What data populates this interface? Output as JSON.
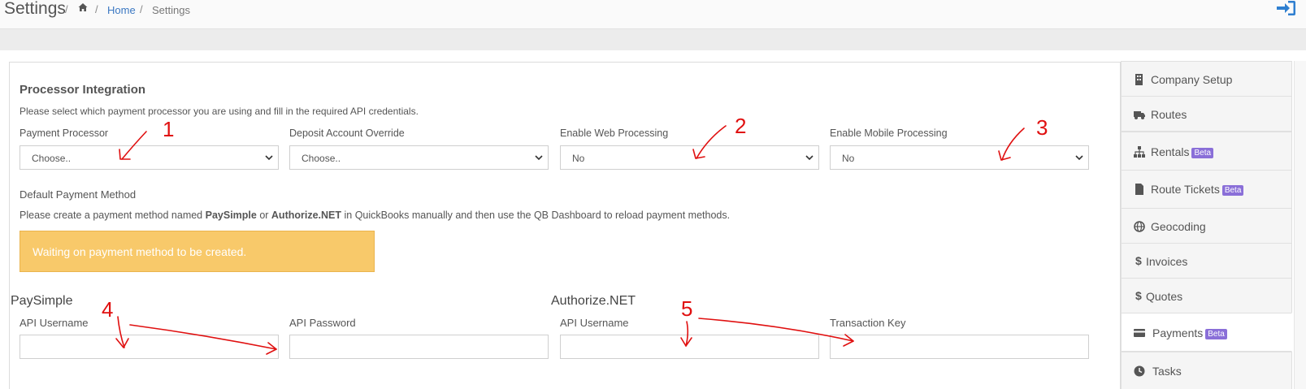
{
  "header": {
    "title": "Settings",
    "breadcrumb": {
      "separator": "/",
      "home": "Home",
      "current": "Settings"
    }
  },
  "processor": {
    "title": "Processor Integration",
    "description": "Please select which payment processor you are using and fill in the required API credentials.",
    "fields": [
      {
        "label": "Payment Processor",
        "value": "Choose.."
      },
      {
        "label": "Deposit Account Override",
        "value": "Choose.."
      },
      {
        "label": "Enable Web Processing",
        "value": "No"
      },
      {
        "label": "Enable Mobile Processing",
        "value": "No"
      }
    ]
  },
  "default_method": {
    "title": "Default Payment Method",
    "text_before": "Please create a payment method named ",
    "name1": "PaySimple",
    "text_or": " or ",
    "name2": "Authorize.NET",
    "text_after": " in QuickBooks manually and then use the QB Dashboard to reload payment methods.",
    "warning": "Waiting on payment method to be created.",
    "warning_color": "#f8c96a"
  },
  "paysimple": {
    "title": "PaySimple",
    "username_label": "API Username",
    "password_label": "API Password"
  },
  "authorize": {
    "title": "Authorize.NET",
    "username_label": "API Username",
    "key_label": "Transaction Key"
  },
  "sidebar": {
    "badge": "Beta",
    "items": [
      {
        "label": "Company Setup",
        "icon": "building-icon"
      },
      {
        "label": "Routes",
        "icon": "truck-icon"
      },
      {
        "label": "Rentals",
        "icon": "sitemap-icon",
        "beta": true
      },
      {
        "label": "Route Tickets",
        "icon": "file-icon",
        "beta": true
      },
      {
        "label": "Geocoding",
        "icon": "globe-icon"
      },
      {
        "label": "Invoices",
        "icon": "dollar-icon"
      },
      {
        "label": "Quotes",
        "icon": "dollar-icon"
      },
      {
        "label": "Payments",
        "icon": "credit-card-icon",
        "beta": true,
        "active": true
      },
      {
        "label": "Tasks",
        "icon": "clock-icon"
      }
    ]
  },
  "annotations": {
    "marks": [
      "1",
      "2",
      "3",
      "4",
      "5"
    ],
    "color": "#e01010"
  },
  "colors": {
    "link": "#3b78c2",
    "badge": "#8a6fd8",
    "logout": "#2f7fd0"
  }
}
